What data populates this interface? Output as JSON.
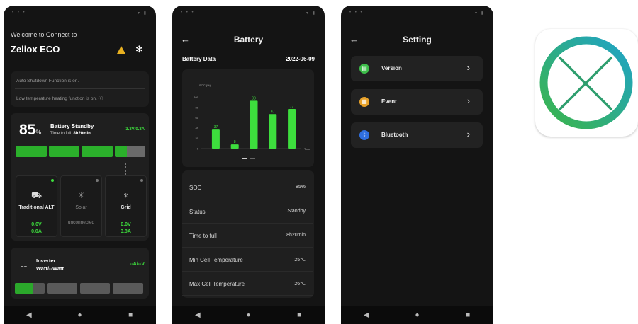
{
  "screen1": {
    "welcome": "Welcome to Connect to",
    "device_name": "Zeliox ECO",
    "warning_icon": "warning-icon",
    "settings_icon": "gear-icon",
    "notice_1": "Auto Shutdown Function is on.",
    "notice_2": "Low temperature heating function is on.",
    "soc_value": "85",
    "soc_unit": "%",
    "battery_state": "Battery Standby",
    "time_to_full_label": "Time to full",
    "time_to_full_value": "8h20min",
    "power_reading": "3.3V/0.3A",
    "soc_level": 0.85,
    "sources": [
      {
        "icon": "engine-icon",
        "label": "Traditional ALT",
        "status": "",
        "v": "0.0V",
        "a": "0.0A",
        "dot": "#3dde3d"
      },
      {
        "icon": "sun-icon",
        "label": "Solar",
        "status": "unconnected",
        "v": "",
        "a": "",
        "dot": "#777777"
      },
      {
        "icon": "tower-icon",
        "label": "Grid",
        "status": "",
        "v": "0.0V",
        "a": "3.8A",
        "dot": "#777777"
      }
    ],
    "inverter_symbol": "--",
    "inverter_label": "Inverter",
    "inverter_power": "Watt/--Watt",
    "inverter_reading": "--A/--V"
  },
  "screen2": {
    "title": "Battery",
    "section": "Battery Data",
    "date": "2022-06-09",
    "chart_data": {
      "type": "bar",
      "ylabel": "SOC (%)",
      "xlabel": "Time",
      "yticks": [
        0,
        20,
        40,
        60,
        80,
        100
      ],
      "ylim": [
        0,
        110
      ],
      "values": [
        37,
        8,
        93,
        67,
        77
      ],
      "color": "#3dde3d"
    },
    "rows": [
      {
        "k": "SOC",
        "v": "85%"
      },
      {
        "k": "Status",
        "v": "Standby"
      },
      {
        "k": "Time to full",
        "v": "8h20min"
      },
      {
        "k": "Min Cell Temperature",
        "v": "25℃"
      },
      {
        "k": "Max Cell Temperature",
        "v": "26℃"
      }
    ]
  },
  "screen3": {
    "title": "Setting",
    "items": [
      {
        "label": "Version",
        "color": "#3dbe4a",
        "icon": "document-icon"
      },
      {
        "label": "Event",
        "color": "#e8a22a",
        "icon": "calendar-icon"
      },
      {
        "label": "Bluetooth",
        "color": "#2f6fe0",
        "icon": "bluetooth-icon"
      }
    ]
  },
  "nav": {
    "back": "◀",
    "home": "●",
    "recents": "■"
  },
  "app_icon": {
    "name": "app-logo-icon"
  }
}
